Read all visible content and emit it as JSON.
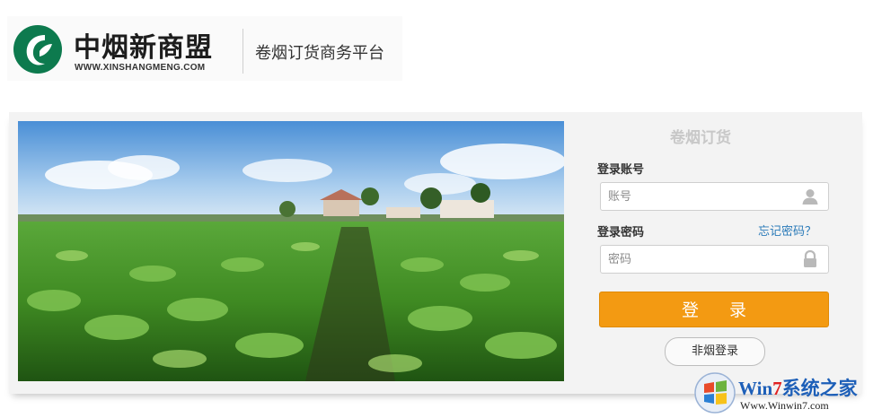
{
  "header": {
    "brand_name": "中烟新商盟",
    "brand_url": "WWW.XINSHANGMENG.COM",
    "slogan": "卷烟订货商务平台"
  },
  "login": {
    "title": "卷烟订货",
    "account_label": "登录账号",
    "account_placeholder": "账号",
    "password_label": "登录密码",
    "forgot_link": "忘记密码？",
    "password_placeholder": "密码",
    "submit_label": "登 录",
    "non_tobacco_label": "非烟登录"
  },
  "watermark": {
    "title_prefix": "Win",
    "title_seven": "7",
    "title_suffix": "系统之家",
    "url": "Www.Winwin7.com"
  },
  "colors": {
    "brand_green": "#0d7a4e",
    "accent_orange": "#f39a12",
    "link_blue": "#2b7bb9"
  },
  "icons": [
    "brand-leaf-logo",
    "user-icon",
    "lock-icon",
    "windows-logo-icon"
  ]
}
